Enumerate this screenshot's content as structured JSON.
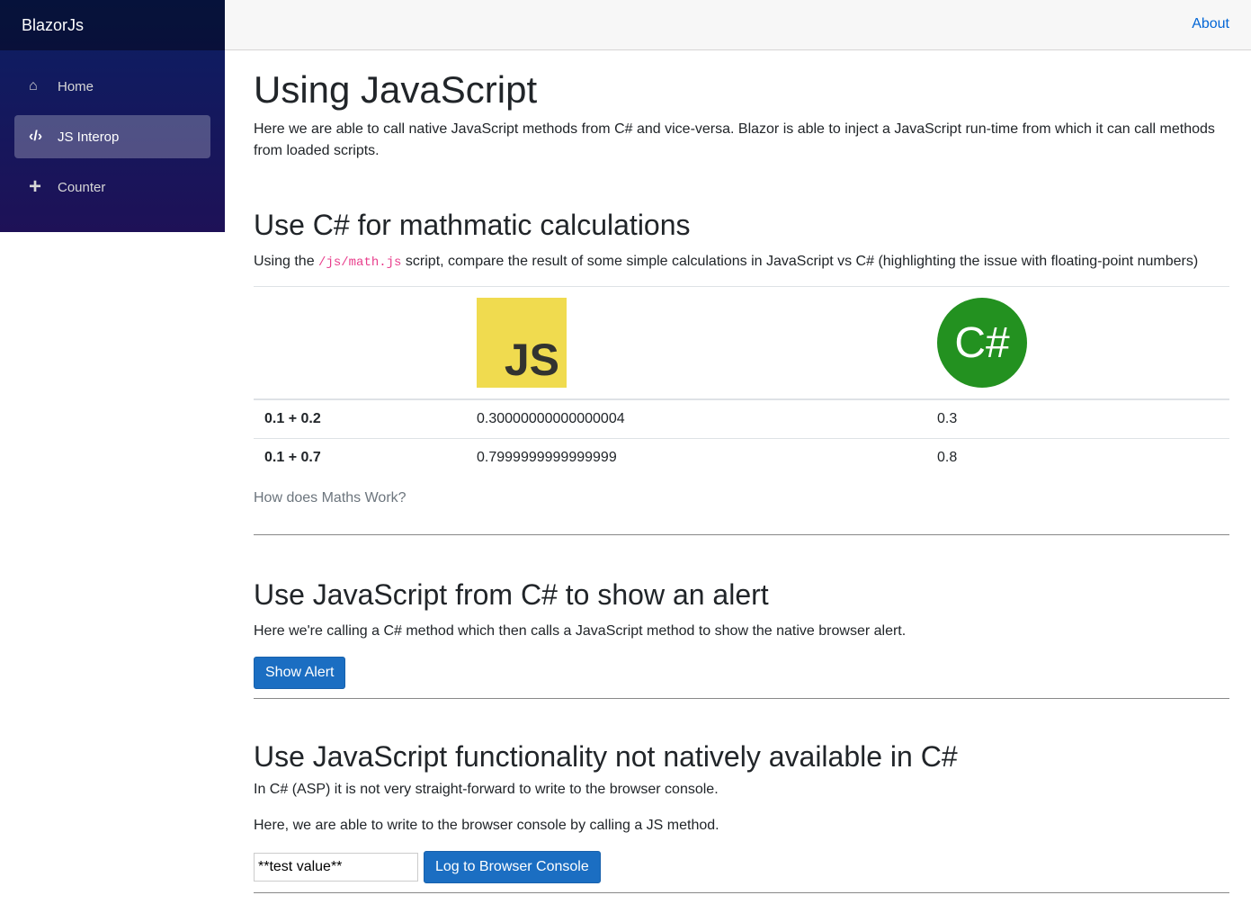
{
  "brand": "BlazorJs",
  "nav": [
    {
      "label": "Home",
      "icon": "home-icon"
    },
    {
      "label": "JS Interop",
      "icon": "code-icon"
    },
    {
      "label": "Counter",
      "icon": "plus-icon"
    }
  ],
  "top": {
    "about": "About"
  },
  "title": "Using JavaScript",
  "intro": "Here we are able to call native JavaScript methods from C# and vice-versa. Blazor is able to inject a JavaScript run-time from which it can call methods from loaded scripts.",
  "math": {
    "heading": "Use C# for mathmatic calculations",
    "pre": "Using the ",
    "code": "/js/math.js",
    "post": " script, compare the result of some simple calculations in JavaScript vs C# (highlighting the issue with floating-point numbers)",
    "js_logo": "JS",
    "cs_logo": "C#",
    "rows": [
      {
        "expr": "0.1 + 0.2",
        "js": "0.30000000000000004",
        "cs": "0.3"
      },
      {
        "expr": "0.1 + 0.7",
        "js": "0.7999999999999999",
        "cs": "0.8"
      }
    ],
    "link": "How does Maths Work?"
  },
  "alert": {
    "heading": "Use JavaScript from C# to show an alert",
    "text": "Here we're calling a C# method which then calls a JavaScript method to show the native browser alert.",
    "button": "Show Alert"
  },
  "console": {
    "heading": "Use JavaScript functionality not natively available in C#",
    "text1": "In C# (ASP) it is not very straight-forward to write to the browser console.",
    "text2": "Here, we are able to write to the browser console by calling a JS method.",
    "input_value": "**test value**",
    "button": "Log to Browser Console"
  }
}
